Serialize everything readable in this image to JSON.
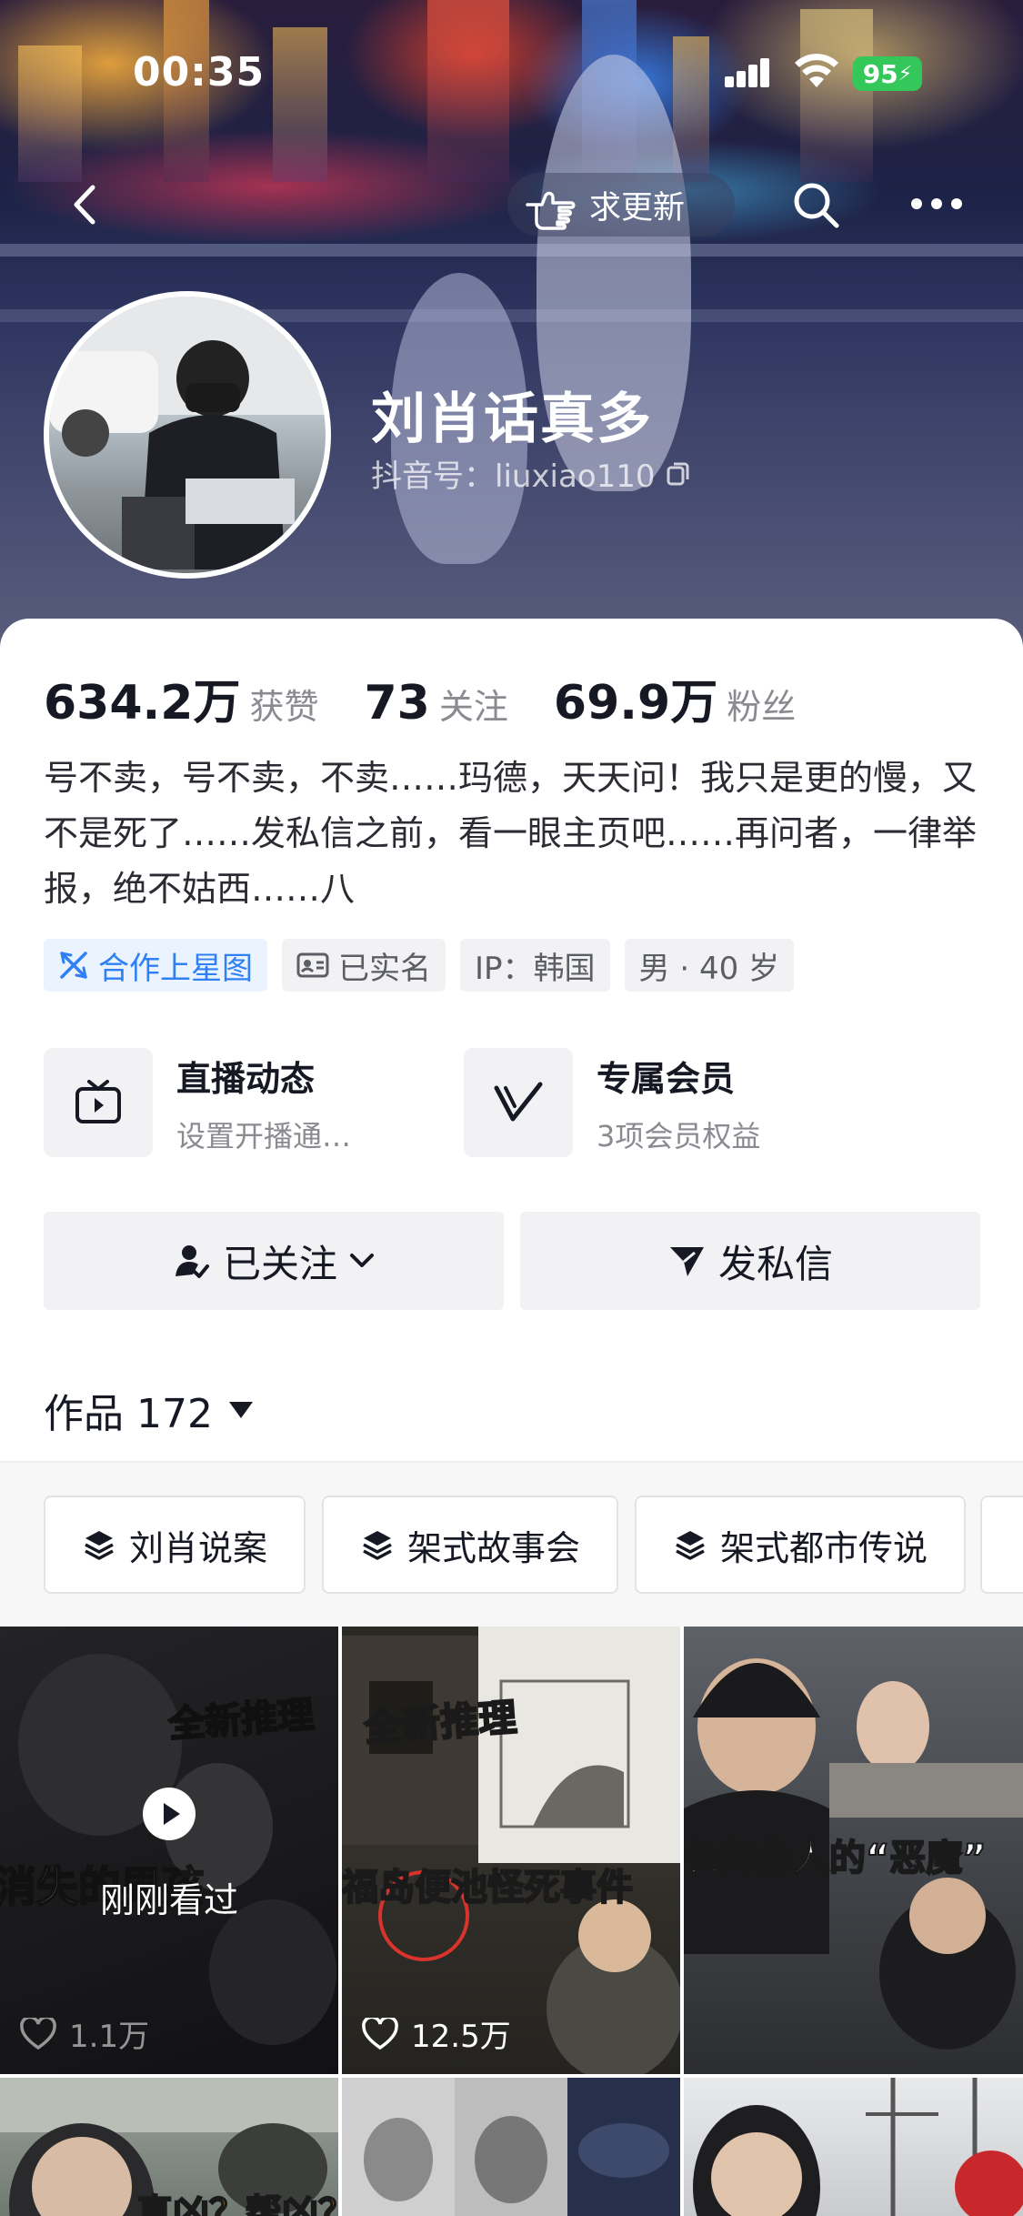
{
  "status_bar": {
    "time": "00:35",
    "battery": "95"
  },
  "navbar": {
    "request_update": "求更新"
  },
  "profile": {
    "name": "刘肖话真多",
    "douyin_id": "抖音号：liuxiao110",
    "stats": [
      {
        "value": "634.2万",
        "label": "获赞"
      },
      {
        "value": "73",
        "label": "关注"
      },
      {
        "value": "69.9万",
        "label": "粉丝"
      }
    ],
    "bio": "号不卖，号不卖，不卖……玛德，天天问！我只是更的慢，又不是死了……发私信之前，看一眼主页吧……再问者，一律举报，绝不姑西……八",
    "tags": [
      {
        "label": "合作上星图",
        "icon": "star-map-icon"
      },
      {
        "label": "已实名",
        "icon": "id-card-icon"
      },
      {
        "label": "IP：韩国"
      },
      {
        "label": "男 · 40 岁"
      }
    ]
  },
  "features": [
    {
      "title": "直播动态",
      "subtitle": "设置开播通…",
      "icon": "tv-icon"
    },
    {
      "title": "专属会员",
      "subtitle": "3项会员权益",
      "icon": "vip-v-icon"
    }
  ],
  "actions": {
    "follow": "已关注",
    "message": "发私信"
  },
  "works": {
    "label": "作品 172"
  },
  "playlists": [
    "刘肖说案",
    "架式故事会",
    "架式都市传说"
  ],
  "videos": [
    {
      "overlay_top": "全新推理",
      "overlay_main": "消失的男孩",
      "badge": "刚刚看过",
      "likes": "1.1万"
    },
    {
      "overlay_top": "全新推理",
      "overlay_main": "福岛便池怪死事件",
      "likes": "12.5万"
    },
    {
      "overlay_main": "长的像人的“恶魔”"
    },
    {
      "overlay_main": "真凶？帮凶？"
    },
    {
      "overlay_main": ""
    },
    {
      "overlay_main": ""
    }
  ],
  "colors": {
    "accent_blue": "#2f7ff5",
    "battery_green": "#34c759",
    "text_primary": "#161823",
    "text_secondary": "#8a8b91"
  }
}
